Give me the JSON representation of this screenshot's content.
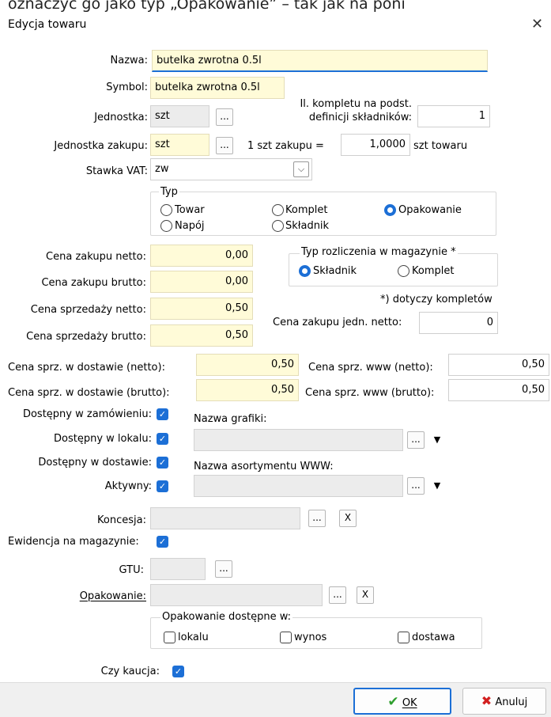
{
  "top_caption": "oznaczyć go jako typ „Opakowanie” – tak jak na poni",
  "window": {
    "title": "Edycja towaru",
    "close_glyph": "✕"
  },
  "fields": {
    "nazwa": {
      "label": "Nazwa:",
      "value": "butelka zwrotna 0.5l"
    },
    "symbol": {
      "label": "Symbol:",
      "value": "butelka zwrotna 0.5l"
    },
    "jednostka": {
      "label": "Jednostka:",
      "value": "szt"
    },
    "kompletu": {
      "label": "Il. kompletu na podst. definicji składników:",
      "value": "1"
    },
    "jednostka_zakupu": {
      "label": "Jednostka zakupu:",
      "value": "szt"
    },
    "przelicznik": {
      "label_left": "1 szt zakupu =",
      "value": "1,0000",
      "label_right": "szt towaru"
    },
    "stawka_vat": {
      "label": "Stawka VAT:",
      "value": "zw"
    },
    "cena_zakupu_netto": {
      "label": "Cena zakupu netto:",
      "value": "0,00"
    },
    "cena_zakupu_brutto": {
      "label": "Cena zakupu brutto:",
      "value": "0,00"
    },
    "cena_sprzedazy_netto": {
      "label": "Cena sprzedaży netto:",
      "value": "0,50"
    },
    "cena_sprzedazy_brutto": {
      "label": "Cena sprzedaży brutto:",
      "value": "0,50"
    },
    "cena_zakupu_jedn_netto": {
      "label": "Cena zakupu jedn. netto:",
      "value": "0"
    },
    "cena_dostawa_netto": {
      "label": "Cena sprz. w dostawie (netto):",
      "value": "0,50"
    },
    "cena_dostawa_brutto": {
      "label": "Cena sprz. w dostawie (brutto):",
      "value": "0,50"
    },
    "cena_www_netto": {
      "label": "Cena sprz. www (netto):",
      "value": "0,50"
    },
    "cena_www_brutto": {
      "label": "Cena sprz. www (brutto):",
      "value": "0,50"
    },
    "nazwa_grafiki": {
      "label": "Nazwa grafiki:",
      "value": ""
    },
    "nazwa_asortymentu": {
      "label": "Nazwa asortymentu WWW:",
      "value": ""
    },
    "koncesja": {
      "label": "Koncesja:",
      "value": ""
    },
    "gtu": {
      "label": "GTU:",
      "value": ""
    },
    "opakowanie": {
      "label": "Opakowanie:",
      "value": ""
    }
  },
  "typ_group": {
    "title": "Typ",
    "options": [
      {
        "label": "Towar",
        "selected": false
      },
      {
        "label": "Komplet",
        "selected": false
      },
      {
        "label": "Opakowanie",
        "selected": true
      },
      {
        "label": "Napój",
        "selected": false
      },
      {
        "label": "Składnik",
        "selected": false
      }
    ]
  },
  "rozliczenie_group": {
    "title": "Typ rozliczenia w magazynie *",
    "options": [
      {
        "label": "Składnik",
        "selected": true
      },
      {
        "label": "Komplet",
        "selected": false
      }
    ],
    "note": "*) dotyczy kompletów"
  },
  "checkboxes": {
    "dostepny_zamowieniu": {
      "label": "Dostępny w zamówieniu:",
      "checked": true
    },
    "dostepny_lokalu": {
      "label": "Dostępny w lokalu:",
      "checked": true
    },
    "dostepny_dostawie": {
      "label": "Dostępny w dostawie:",
      "checked": true
    },
    "aktywny": {
      "label": "Aktywny:",
      "checked": true
    },
    "ewidencja": {
      "label": "Ewidencja na magazynie:",
      "checked": true
    },
    "czy_kaucja": {
      "label": "Czy kaucja:",
      "checked": true
    }
  },
  "opakowanie_dostepne": {
    "title": "Opakowanie dostępne w:",
    "options": [
      {
        "label": "lokalu",
        "checked": false
      },
      {
        "label": "wynos",
        "checked": false
      },
      {
        "label": "dostawa",
        "checked": false
      }
    ]
  },
  "buttons": {
    "browse": "...",
    "clear": "X",
    "ok": "OK",
    "cancel": "Anuluj"
  },
  "colors": {
    "accent": "#1c6fd6",
    "field_yellow": "#fffbd8",
    "field_gray": "#ececec",
    "ok_green": "#2e9e2e",
    "cancel_red": "#d21f1f"
  }
}
